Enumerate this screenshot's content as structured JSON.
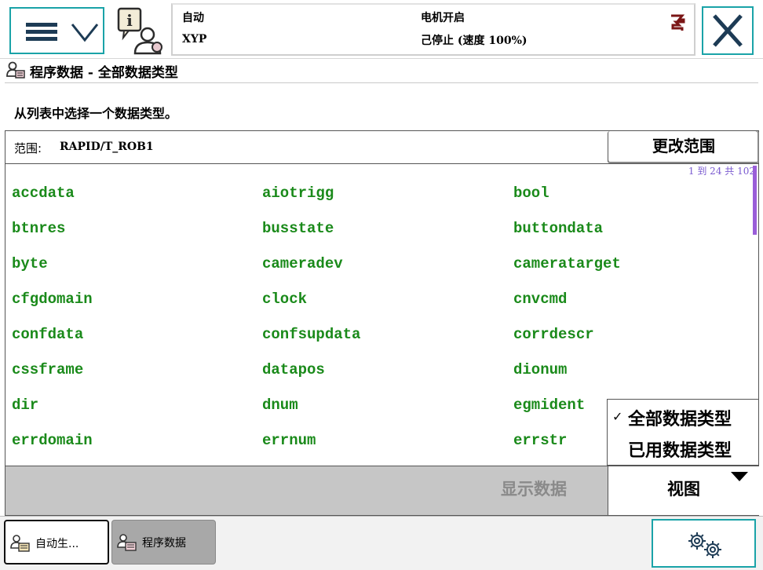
{
  "statusbar": {
    "mode": "自动",
    "system_name": "XYP",
    "motor_state": "电机开启",
    "run_state": "己停止 (速度 100%)"
  },
  "page": {
    "title": "程序数据 - 全部数据类型",
    "instruction": "从列表中选择一个数据类型。"
  },
  "scope": {
    "label": "范围:",
    "value": "RAPID/T_ROB1",
    "change_button": "更改范围"
  },
  "list": {
    "count_text": "1 到 24 共 102",
    "items": [
      "accdata",
      "aiotrigg",
      "bool",
      "btnres",
      "busstate",
      "buttondata",
      "byte",
      "cameradev",
      "cameratarget",
      "cfgdomain",
      "clock",
      "cnvcmd",
      "confdata",
      "confsupdata",
      "corrdescr",
      "cssframe",
      "datapos",
      "dionum",
      "dir",
      "dnum",
      "egmident",
      "errdomain",
      "errnum",
      "errstr"
    ]
  },
  "view_menu": {
    "items": [
      {
        "label": "全部数据类型",
        "checked": true
      },
      {
        "label": "已用数据类型",
        "checked": false
      }
    ],
    "check_mark": "✓"
  },
  "actions": {
    "show_data": "显示数据",
    "view": "视图"
  },
  "taskbar": {
    "tasks": [
      {
        "label": "自动生...",
        "active": true
      },
      {
        "label": "程序数据",
        "active": false
      }
    ]
  },
  "colors": {
    "accent": "#1aa3a8",
    "list_text": "#1a8a1a",
    "disabled_text": "#8a8a8a",
    "count_text": "#7a5ad0"
  }
}
